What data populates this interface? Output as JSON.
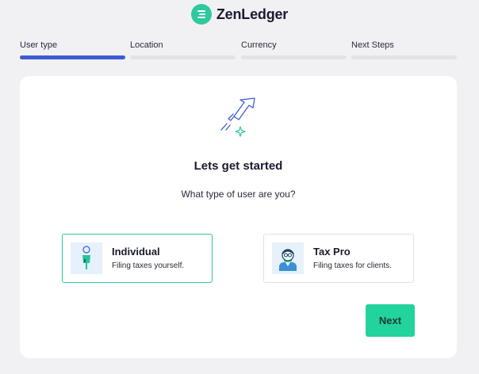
{
  "brand": {
    "name": "ZenLedger",
    "logo_icon": "zenledger-logo",
    "color": "#2ec99e"
  },
  "stepper": {
    "active_color": "#3d5ad6",
    "steps": [
      {
        "label": "User type",
        "active": true
      },
      {
        "label": "Location",
        "active": false
      },
      {
        "label": "Currency",
        "active": false
      },
      {
        "label": "Next Steps",
        "active": false
      }
    ]
  },
  "onboarding": {
    "hero_icon": "rocket-launch-icon",
    "title": "Lets get started",
    "question": "What type of user are you?",
    "options": [
      {
        "title": "Individual",
        "description": "Filing taxes yourself.",
        "icon": "individual-person-icon",
        "selected": true
      },
      {
        "title": "Tax Pro",
        "description": "Filing taxes for clients.",
        "icon": "tax-pro-icon",
        "selected": false
      }
    ],
    "next_label": "Next",
    "accent_color": "#22d39d"
  }
}
